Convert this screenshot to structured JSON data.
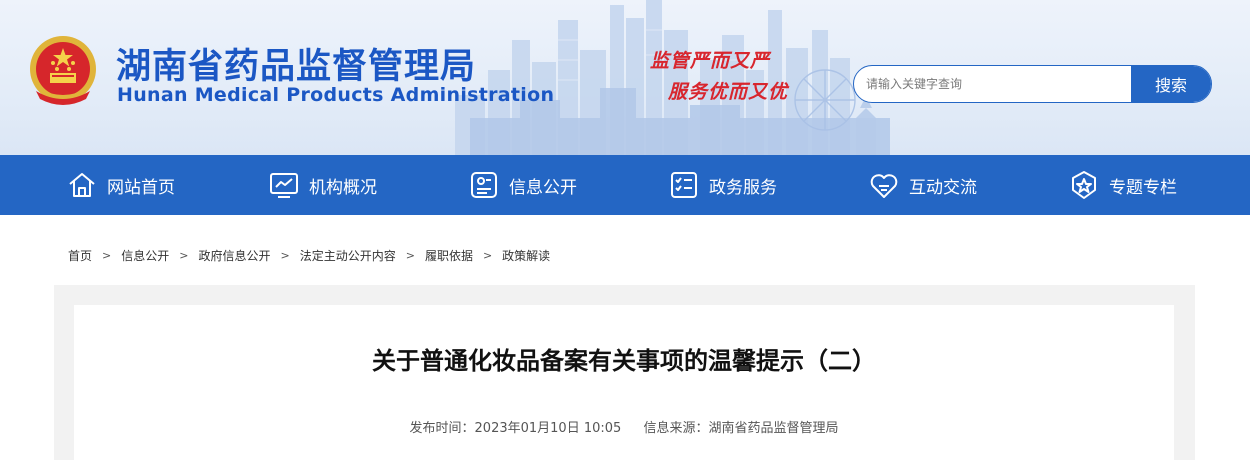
{
  "header": {
    "title_cn": "湖南省药品监督管理局",
    "title_en": "Hunan Medical Products Administration",
    "slogan_line1": "监管严而又严",
    "slogan_line2": "服务优而又优",
    "emblem_icon": "national-emblem-icon"
  },
  "search": {
    "placeholder": "请输入关键字查询",
    "button_label": "搜索"
  },
  "nav": {
    "items": [
      {
        "label": "网站首页",
        "icon": "home-icon"
      },
      {
        "label": "机构概况",
        "icon": "chart-monitor-icon"
      },
      {
        "label": "信息公开",
        "icon": "id-card-icon"
      },
      {
        "label": "政务服务",
        "icon": "checklist-icon"
      },
      {
        "label": "互动交流",
        "icon": "heart-chat-icon"
      },
      {
        "label": "专题专栏",
        "icon": "star-badge-icon"
      }
    ]
  },
  "breadcrumb": {
    "items": [
      "首页",
      "信息公开",
      "政府信息公开",
      "法定主动公开内容",
      "履职依据",
      "政策解读"
    ],
    "separator": ">"
  },
  "article": {
    "title": "关于普通化妆品备案有关事项的温馨提示（二）",
    "publish_time": "发布时间：2023年01月10日 10:05",
    "source": "信息来源：湖南省药品监督管理局"
  },
  "colors": {
    "brand_blue": "#2466c4",
    "slogan_red": "#d8262e",
    "content_bg": "#f2f2f2"
  }
}
